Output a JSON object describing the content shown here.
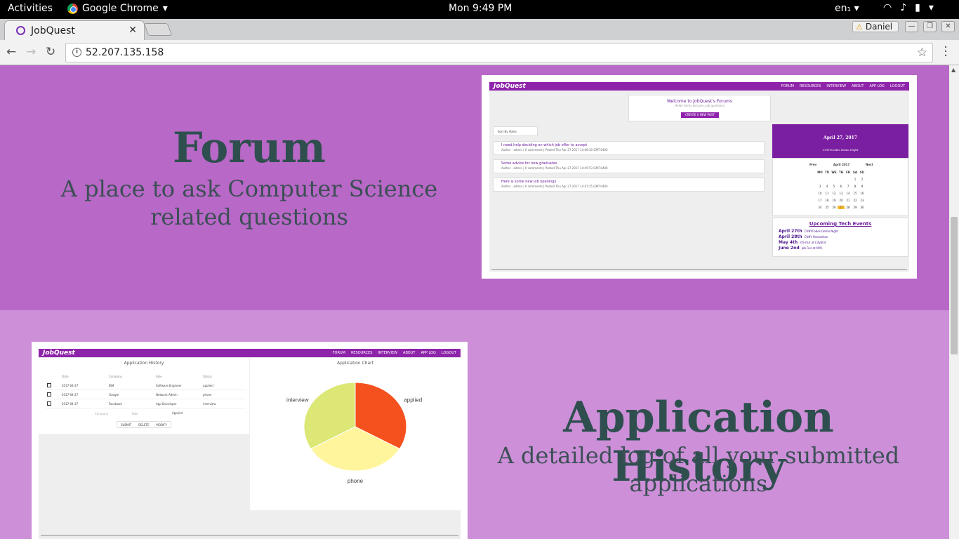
{
  "system_bar": {
    "activities": "Activities",
    "app_name": "Google Chrome",
    "clock": "Mon  9:49 PM",
    "language": "en₁"
  },
  "browser": {
    "tab_title": "JobQuest",
    "profile_name": "Daniel",
    "url": "52.207.135.158"
  },
  "forum_section": {
    "title": "Forum",
    "subtitle": "A place to ask Computer Science related questions",
    "screenshot": {
      "logo": "JobQuest",
      "nav": [
        "FORUM",
        "RESOURCES",
        "INTERVIEW",
        "ABOUT",
        "APP LOG",
        "LOGOUT"
      ],
      "welcome_title": "Welcome to JobQuest's Forums",
      "welcome_sub": "Hello! Items lectures, job questions",
      "new_post_button": "CREATE A NEW POST",
      "sort_label": "Sort By Votes",
      "posts": [
        {
          "title": "I need help deciding on which job offer to accept",
          "meta": "Author - admin  |  0 comments  |  Posted Thu Apr 27 2017 14:48:30 GMT-0400"
        },
        {
          "title": "Some advice for new graduates",
          "meta": "Author - admin  |  0 comments  |  Posted Thu Apr 27 2017 14:45:53 GMT-0400"
        },
        {
          "title": "Here is some new job openings",
          "meta": "Author - admin  |  0 comments  |  Posted Thu Apr 27 2017 14:47:25 GMT-0400"
        }
      ],
      "calendar": {
        "date_title": "April 27, 2017",
        "event_title": "CUNYCodes Demo Night",
        "prev": "Prev",
        "next": "Next",
        "month": "April 2017",
        "weekdays": [
          "MO",
          "TU",
          "WE",
          "TH",
          "FR",
          "SA",
          "SU"
        ],
        "weeks": [
          [
            "",
            "",
            "",
            "",
            "",
            "1",
            "2"
          ],
          [
            "3",
            "4",
            "5",
            "6",
            "7",
            "8",
            "9"
          ],
          [
            "10",
            "11",
            "12",
            "13",
            "14",
            "15",
            "16"
          ],
          [
            "17",
            "18",
            "19",
            "20",
            "21",
            "22",
            "23"
          ],
          [
            "24",
            "25",
            "26",
            "27",
            "28",
            "29",
            "30"
          ]
        ],
        "highlight": "27"
      },
      "upcoming_title": "Upcoming Tech Events",
      "events": [
        {
          "date": "April 27th",
          "name": "CUNYCodes Demo Night"
        },
        {
          "date": "April 28th",
          "name": "CUNY Hackathon"
        },
        {
          "date": "May 4th",
          "name": "iOS Fair at Citybird"
        },
        {
          "date": "June 2nd",
          "name": "Job Fair at NYU"
        }
      ]
    }
  },
  "app_section": {
    "title": "Application History",
    "subtitle": "A detailed log of all your submitted applications",
    "screenshot": {
      "logo": "JobQuest",
      "nav": [
        "FORUM",
        "RESOURCES",
        "INTERVIEW",
        "ABOUT",
        "APP LOG",
        "LOGOUT"
      ],
      "table_title": "Application History",
      "columns": [
        "Date",
        "Company",
        "Role",
        "Status"
      ],
      "rows": [
        [
          "2017-04-27",
          "IBM",
          "Software Engineer",
          "applied"
        ],
        [
          "2017-04-27",
          "Google",
          "Network Admin",
          "phone"
        ],
        [
          "2017-04-27",
          "Facebook",
          "App Developer",
          "interview"
        ]
      ],
      "form_company": "Company",
      "form_role": "Role",
      "form_status": "Applied",
      "buttons": [
        "SUBMIT",
        "DELETE",
        "MODIFY"
      ],
      "chart_title": "Application Chart"
    }
  },
  "chart_data": {
    "type": "pie",
    "categories": [
      "applied",
      "phone",
      "interview"
    ],
    "values": [
      1,
      1,
      1
    ],
    "colors": [
      "#f4511e",
      "#fff59d",
      "#dce775"
    ],
    "title": "Application Chart"
  }
}
